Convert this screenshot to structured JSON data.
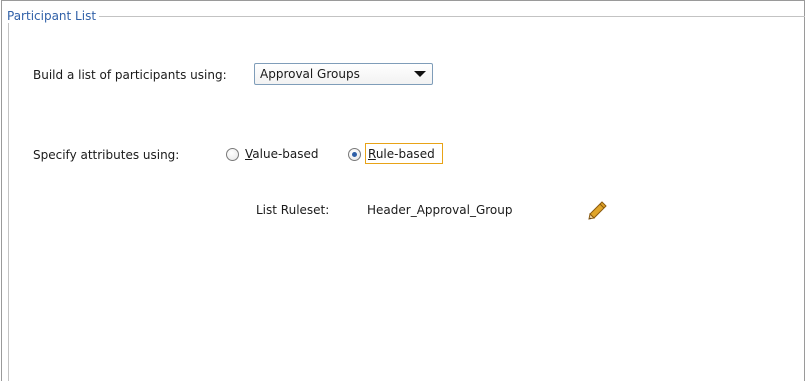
{
  "panel": {
    "title": "Participant List"
  },
  "build_list": {
    "label": "Build a list of participants using:",
    "selected": "Approval Groups"
  },
  "specify_attributes": {
    "label": "Specify attributes using:",
    "options": [
      {
        "mnemonic": "V",
        "rest": "alue-based",
        "selected": false
      },
      {
        "mnemonic": "R",
        "rest": "ule-based",
        "selected": true
      }
    ]
  },
  "list_ruleset": {
    "label": "List Ruleset:",
    "value": "Header_Approval_Group",
    "edit_icon": "pencil-icon"
  },
  "colors": {
    "legend_text": "#3161a8",
    "focus_border": "#e8a317",
    "radio_dot": "#2e5ea6",
    "pencil_body": "#e0a52a"
  }
}
